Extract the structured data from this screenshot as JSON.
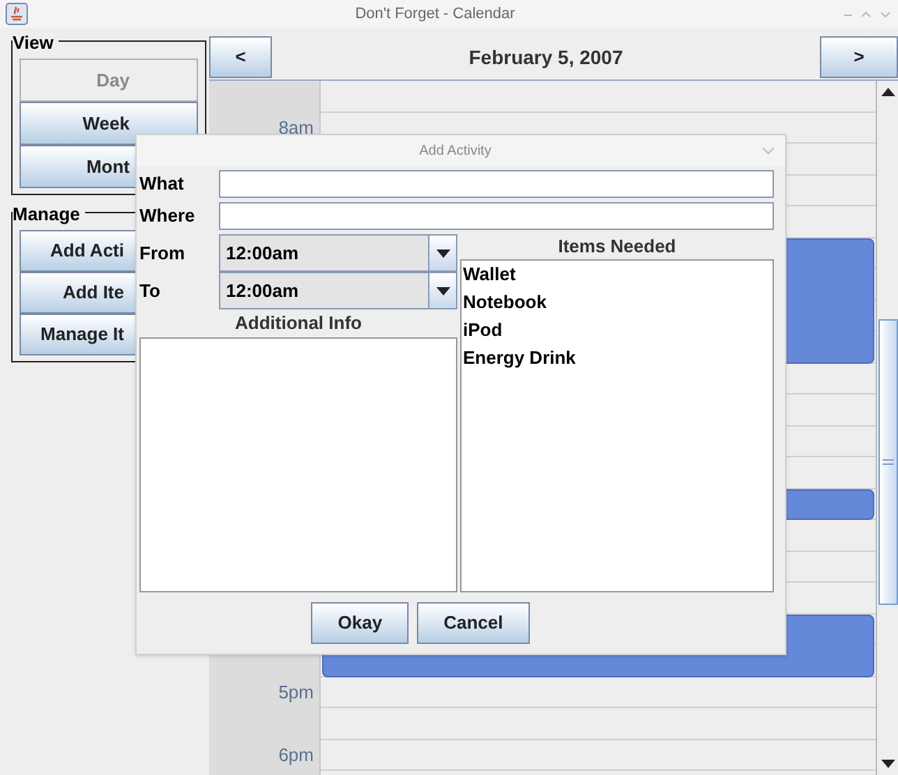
{
  "window": {
    "title": "Don't Forget - Calendar"
  },
  "view_group": {
    "title": "View",
    "buttons": [
      {
        "label": "Day",
        "selected": true
      },
      {
        "label": "Week",
        "selected": false
      },
      {
        "label": "Mont",
        "selected": false
      }
    ]
  },
  "manage_group": {
    "title": "Manage",
    "buttons": [
      "Add Acti",
      "Add Ite",
      "Manage It"
    ]
  },
  "calendar": {
    "prev": "<",
    "date": "February 5, 2007",
    "next": ">",
    "rows": [
      {
        "kind": "empty"
      },
      {
        "kind": "empty",
        "label": "8am"
      },
      {
        "kind": "empty"
      },
      {
        "kind": "empty"
      },
      {
        "kind": "empty"
      },
      {
        "kind": "event"
      },
      {
        "kind": "event"
      },
      {
        "kind": "event"
      },
      {
        "kind": "event"
      },
      {
        "kind": "empty"
      },
      {
        "kind": "empty"
      },
      {
        "kind": "empty"
      },
      {
        "kind": "empty"
      },
      {
        "kind": "event"
      },
      {
        "kind": "empty"
      },
      {
        "kind": "empty"
      },
      {
        "kind": "empty"
      },
      {
        "kind": "event"
      },
      {
        "kind": "event"
      },
      {
        "kind": "empty",
        "label": "5pm"
      },
      {
        "kind": "empty"
      },
      {
        "kind": "empty",
        "label": "6pm"
      }
    ]
  },
  "dialog": {
    "title": "Add Activity",
    "what_label": "What",
    "where_label": "Where",
    "from_label": "From",
    "from_value": "12:00am",
    "to_label": "To",
    "to_value": "12:00am",
    "info_title": "Additional Info",
    "items_title": "Items Needed",
    "items": [
      "Wallet",
      "Notebook",
      "iPod",
      "Energy Drink"
    ],
    "buttons": [
      "Okay",
      "Cancel"
    ]
  }
}
